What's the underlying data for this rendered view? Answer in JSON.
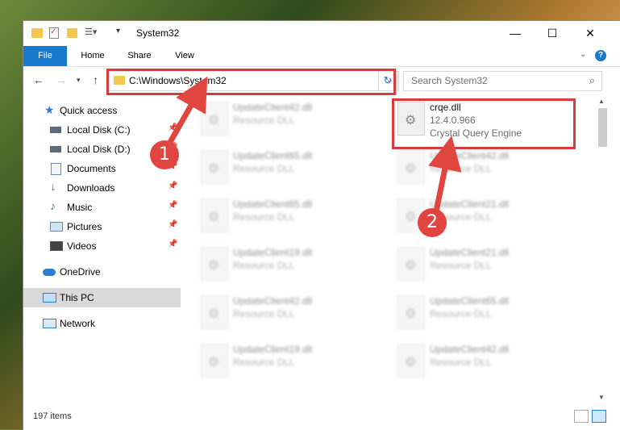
{
  "window": {
    "title": "System32"
  },
  "ribbon": {
    "tabs": [
      "File",
      "Home",
      "Share",
      "View"
    ]
  },
  "nav": {
    "address": "C:\\Windows\\System32",
    "search_placeholder": "Search System32"
  },
  "sidebar": {
    "items": [
      {
        "label": "Quick access",
        "icon": "star-icon"
      },
      {
        "label": "Local Disk (C:)",
        "icon": "drive-icon"
      },
      {
        "label": "Local Disk (D:)",
        "icon": "drive-icon"
      },
      {
        "label": "Documents",
        "icon": "documents-icon"
      },
      {
        "label": "Downloads",
        "icon": "download-icon"
      },
      {
        "label": "Music",
        "icon": "music-icon"
      },
      {
        "label": "Pictures",
        "icon": "pictures-icon"
      },
      {
        "label": "Videos",
        "icon": "videos-icon"
      },
      {
        "label": "OneDrive",
        "icon": "cloud-icon"
      },
      {
        "label": "This PC",
        "icon": "computer-icon"
      },
      {
        "label": "Network",
        "icon": "network-icon"
      }
    ]
  },
  "files": {
    "highlight": {
      "name": "crqe.dll",
      "version": "12.4.0.966",
      "description": "Crystal Query Engine"
    },
    "left_col": [
      {
        "name": "UpdateClient42.dll",
        "type": "Resource DLL"
      },
      {
        "name": "UpdateClient65.dll",
        "type": "Resource DLL"
      },
      {
        "name": "UpdateClient65.dll",
        "type": "Resource DLL"
      },
      {
        "name": "UpdateClient19.dll",
        "type": "Resource DLL"
      },
      {
        "name": "UpdateClient42.dll",
        "type": "Resource DLL"
      },
      {
        "name": "UpdateClient19.dll",
        "type": "Resource DLL"
      }
    ],
    "right_col": [
      {
        "name": "UpdateClient42.dll",
        "type": "Resource DLL"
      },
      {
        "name": "UpdateClient21.dll",
        "type": "Resource DLL"
      },
      {
        "name": "UpdateClient21.dll",
        "type": "Resource DLL"
      },
      {
        "name": "UpdateClient65.dll",
        "type": "Resource DLL"
      },
      {
        "name": "UpdateClient42.dll",
        "type": "Resource DLL"
      }
    ]
  },
  "status": {
    "count": "197 items"
  },
  "annotations": {
    "step1": "1",
    "step2": "2"
  },
  "colors": {
    "accent": "#1979ca",
    "highlight": "#d93a3a"
  }
}
